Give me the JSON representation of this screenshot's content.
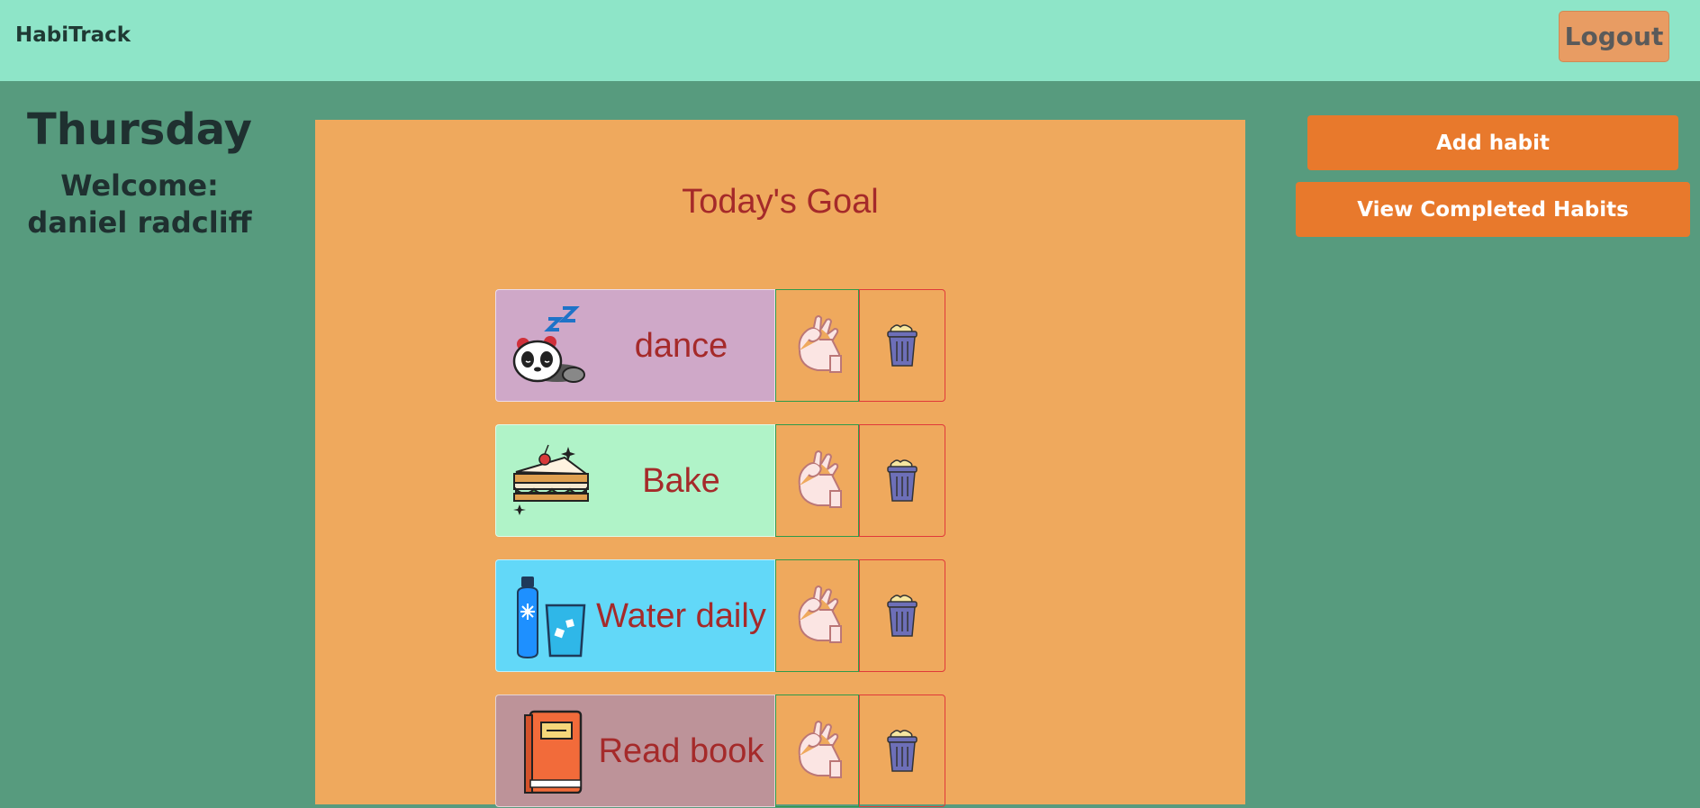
{
  "header": {
    "brand": "HabiTrack",
    "logout_label": "Logout"
  },
  "sidebar": {
    "day": "Thursday",
    "welcome": "Welcome: daniel radcliff"
  },
  "main": {
    "title": "Today's Goal",
    "habits": [
      {
        "name": "dance",
        "bg": "#cfa8c8",
        "icon": "sleeping-panda-icon"
      },
      {
        "name": "Bake",
        "bg": "#b0f3c8",
        "icon": "sandwich-cake-icon"
      },
      {
        "name": "Water daily",
        "bg": "#62d8f8",
        "icon": "water-bottle-glass-icon"
      },
      {
        "name": "Read book",
        "bg": "#bd9399",
        "icon": "book-icon"
      }
    ]
  },
  "actions": {
    "add_habit": "Add habit",
    "view_completed": "View Completed Habits"
  },
  "colors": {
    "header_bg": "#8ee5c8",
    "page_bg": "#579b7e",
    "panel_bg": "#efa95d",
    "accent": "#e8792c",
    "habit_text": "#a52a2a"
  }
}
